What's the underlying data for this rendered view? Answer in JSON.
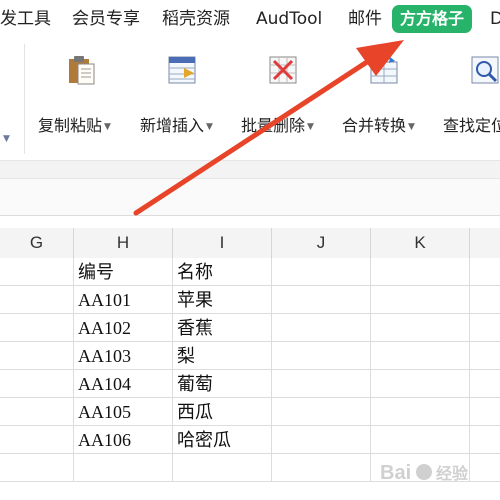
{
  "menu": {
    "items": [
      "发工具",
      "会员专享",
      "稻壳资源",
      "AudTool",
      "邮件",
      "方方格子",
      "D"
    ],
    "active_index": 5,
    "active_color": "#28b36b"
  },
  "ribbon": {
    "tools": [
      {
        "label": "复制粘贴",
        "icon": "clipboard-paste-icon"
      },
      {
        "label": "新增插入",
        "icon": "insert-rows-icon"
      },
      {
        "label": "批量删除",
        "icon": "delete-x-icon"
      },
      {
        "label": "合并转换",
        "icon": "merge-convert-icon"
      },
      {
        "label": "查找定位",
        "icon": "find-magnifier-icon"
      }
    ]
  },
  "sheet": {
    "columns": [
      "G",
      "H",
      "I",
      "J",
      "K"
    ],
    "rows": [
      [
        "",
        "编号",
        "名称",
        "",
        ""
      ],
      [
        "",
        "AA101",
        "苹果",
        "",
        ""
      ],
      [
        "",
        "AA102",
        "香蕉",
        "",
        ""
      ],
      [
        "",
        "AA103",
        "梨",
        "",
        ""
      ],
      [
        "",
        "AA104",
        "葡萄",
        "",
        ""
      ],
      [
        "",
        "AA105",
        "西瓜",
        "",
        ""
      ],
      [
        "",
        "AA106",
        "哈密瓜",
        "",
        ""
      ],
      [
        "",
        "",
        "",
        "",
        ""
      ]
    ]
  },
  "annotation": {
    "arrow_color": "#e8442a"
  },
  "watermark": {
    "text": "Bai 经验"
  }
}
